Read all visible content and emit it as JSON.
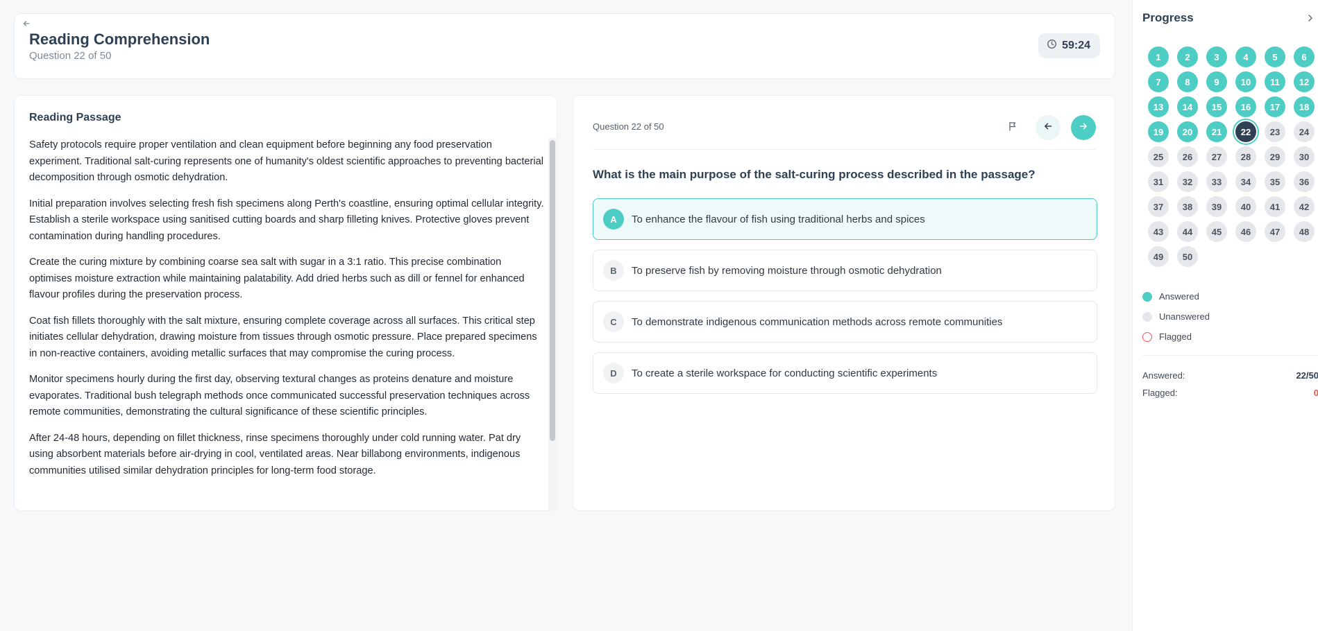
{
  "header": {
    "title": "Reading Comprehension",
    "subtitle": "Question 22 of 50",
    "timer": "59:24"
  },
  "passage": {
    "title": "Reading Passage",
    "paragraphs": [
      "Safety protocols require proper ventilation and clean equipment before beginning any food preservation experiment. Traditional salt-curing represents one of humanity's oldest scientific approaches to preventing bacterial decomposition through osmotic dehydration.",
      "Initial preparation involves selecting fresh fish specimens along Perth's coastline, ensuring optimal cellular integrity. Establish a sterile workspace using sanitised cutting boards and sharp filleting knives. Protective gloves prevent contamination during handling procedures.",
      "Create the curing mixture by combining coarse sea salt with sugar in a 3:1 ratio. This precise combination optimises moisture extraction while maintaining palatability. Add dried herbs such as dill or fennel for enhanced flavour profiles during the preservation process.",
      "Coat fish fillets thoroughly with the salt mixture, ensuring complete coverage across all surfaces. This critical step initiates cellular dehydration, drawing moisture from tissues through osmotic pressure. Place prepared specimens in non-reactive containers, avoiding metallic surfaces that may compromise the curing process.",
      "Monitor specimens hourly during the first day, observing textural changes as proteins denature and moisture evaporates. Traditional bush telegraph methods once communicated successful preservation techniques across remote communities, demonstrating the cultural significance of these scientific principles.",
      "After 24-48 hours, depending on fillet thickness, rinse specimens thoroughly under cold running water. Pat dry using absorbent materials before air-drying in cool, ventilated areas. Near billabong environments, indigenous communities utilised similar dehydration principles for long-term food storage."
    ]
  },
  "question": {
    "counter": "Question 22 of 50",
    "text": "What is the main purpose of the salt-curing process described in the passage?",
    "selected": "A",
    "options": [
      {
        "letter": "A",
        "text": "To enhance the flavour of fish using traditional herbs and spices"
      },
      {
        "letter": "B",
        "text": "To preserve fish by removing moisture through osmotic dehydration"
      },
      {
        "letter": "C",
        "text": "To demonstrate indigenous communication methods across remote communities"
      },
      {
        "letter": "D",
        "text": "To create a sterile workspace for conducting scientific experiments"
      }
    ]
  },
  "progress": {
    "title": "Progress",
    "total": 50,
    "answered_count": 21,
    "current": 22,
    "legend": {
      "answered": "Answered",
      "unanswered": "Unanswered",
      "flagged": "Flagged"
    },
    "stats": {
      "answered_label": "Answered:",
      "answered_value": "22/50",
      "flagged_label": "Flagged:",
      "flagged_value": "0"
    }
  },
  "colors": {
    "accent": "#4ecdc4",
    "navy": "#2f4055",
    "flag_red": "#e65a5a"
  }
}
